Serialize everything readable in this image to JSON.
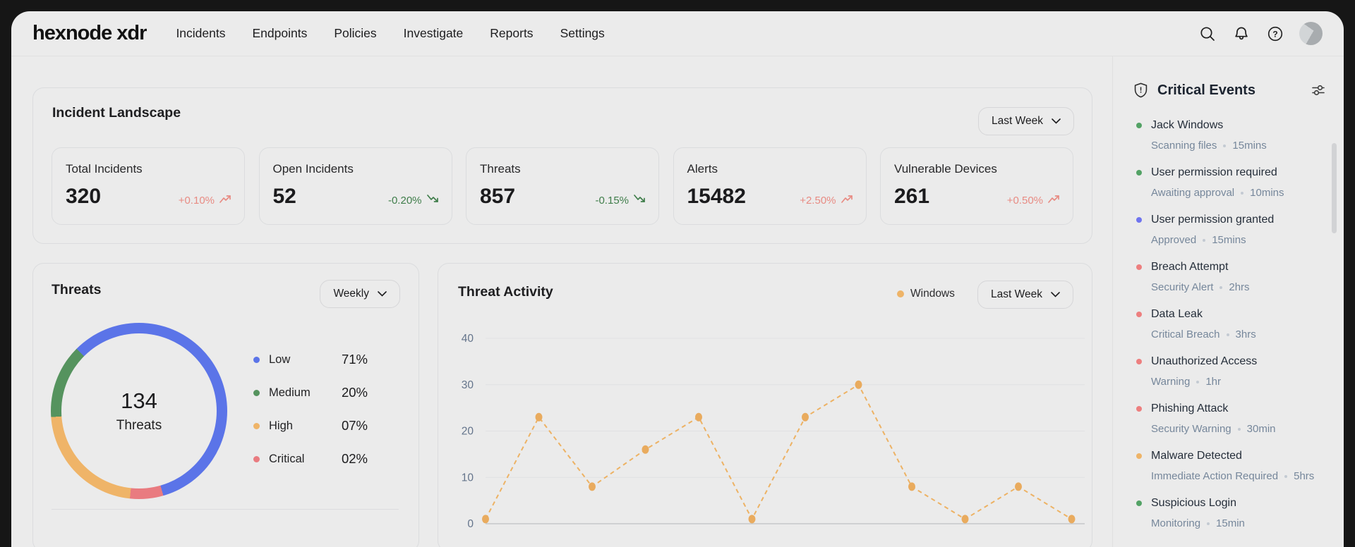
{
  "topbar": {
    "logo": "hexnode xdr",
    "nav": [
      {
        "label": "Incidents"
      },
      {
        "label": "Endpoints"
      },
      {
        "label": "Policies"
      },
      {
        "label": "Investigate"
      },
      {
        "label": "Reports"
      },
      {
        "label": "Settings"
      }
    ]
  },
  "incident_landscape": {
    "title": "Incident Landscape",
    "range_selector": "Last Week",
    "stats": [
      {
        "label": "Total Incidents",
        "value": "320",
        "delta": "+0.10%",
        "trend": "up",
        "delta_color": "#e88b83"
      },
      {
        "label": "Open Incidents",
        "value": "52",
        "delta": "-0.20%",
        "trend": "down",
        "delta_color": "#3f7d4a"
      },
      {
        "label": "Threats",
        "value": "857",
        "delta": "-0.15%",
        "trend": "down",
        "delta_color": "#3f7d4a"
      },
      {
        "label": "Alerts",
        "value": "15482",
        "delta": "+2.50%",
        "trend": "up",
        "delta_color": "#e88b83"
      },
      {
        "label": "Vulnerable Devices",
        "value": "261",
        "delta": "+0.50%",
        "trend": "up",
        "delta_color": "#e88b83"
      }
    ]
  },
  "threats": {
    "title": "Threats",
    "range_selector": "Weekly",
    "chart_data": {
      "type": "pie",
      "center_value": "134",
      "center_label": "Threats",
      "slices": [
        {
          "label": "Low",
          "value": 71,
          "pct_label": "71%",
          "color": "#5b74e8",
          "arc_deg": 209
        },
        {
          "label": "Medium",
          "value": 20,
          "pct_label": "20%",
          "color": "#55935e",
          "arc_deg": 49
        },
        {
          "label": "High",
          "value": 7,
          "pct_label": "07%",
          "color": "#efb468",
          "arc_deg": 80
        },
        {
          "label": "Critical",
          "value": 2,
          "pct_label": "02%",
          "color": "#e97b80",
          "arc_deg": 22
        }
      ],
      "draw_order": [
        0,
        3,
        2,
        1
      ],
      "start_angle_deg": -45,
      "legend_position": "right"
    }
  },
  "threat_activity": {
    "title": "Threat Activity",
    "range_selector": "Last Week",
    "legend": [
      {
        "label": "Windows",
        "color": "#eeb468"
      }
    ],
    "chart_data": {
      "type": "line",
      "series": [
        {
          "name": "Windows",
          "values": [
            1,
            23,
            8,
            16,
            23,
            1,
            23,
            30,
            8,
            1,
            8,
            1
          ]
        }
      ],
      "ylim": [
        0,
        40
      ],
      "yticks": [
        0,
        10,
        20,
        30,
        40
      ],
      "grid": "horizontal",
      "line_style": "dashed-with-dots",
      "color": "#edb264",
      "dot_color": "#e9ab5e"
    }
  },
  "critical_events": {
    "title": "Critical Events",
    "items": [
      {
        "title": "Jack Windows",
        "status": "Scanning files",
        "time": "15mins",
        "severity_color": "#53a265"
      },
      {
        "title": "User permission required",
        "status": "Awaiting approval",
        "time": "10mins",
        "severity_color": "#53a265"
      },
      {
        "title": "User permission granted",
        "status": "Approved",
        "time": "15mins",
        "severity_color": "#6f74ef"
      },
      {
        "title": "Breach Attempt",
        "status": "Security Alert",
        "time": "2hrs",
        "severity_color": "#ed7f7f"
      },
      {
        "title": "Data Leak",
        "status": "Critical Breach",
        "time": "3hrs",
        "severity_color": "#ed7f7f"
      },
      {
        "title": "Unauthorized Access",
        "status": "Warning",
        "time": "1hr",
        "severity_color": "#ed7f7f"
      },
      {
        "title": "Phishing Attack",
        "status": "Security Warning",
        "time": "30min",
        "severity_color": "#ed7f7f"
      },
      {
        "title": "Malware Detected",
        "status": "Immediate Action Required",
        "time": "5hrs",
        "severity_color": "#eeb468"
      },
      {
        "title": "Suspicious Login",
        "status": "Monitoring",
        "time": "15min",
        "severity_color": "#53a265"
      }
    ]
  }
}
